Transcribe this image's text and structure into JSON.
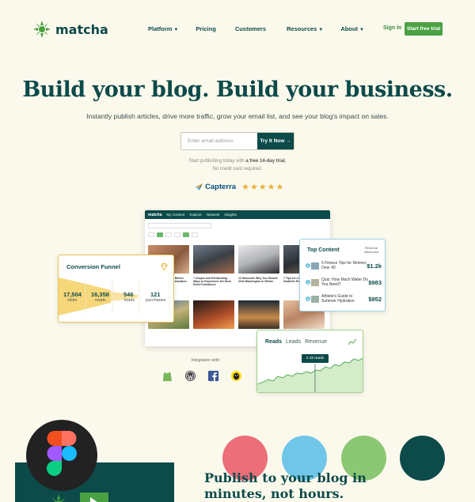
{
  "nav": {
    "brand": "matcha",
    "links": [
      {
        "label": "Platform",
        "caret": "▼"
      },
      {
        "label": "Pricing",
        "caret": ""
      },
      {
        "label": "Customers",
        "caret": ""
      },
      {
        "label": "Resources",
        "caret": "▼"
      },
      {
        "label": "About",
        "caret": "▼"
      }
    ],
    "sign_in": "Sign In",
    "cta": "Start free trial"
  },
  "hero": {
    "headline": "Build your blog. Build your business.",
    "subhead": "Instantly publish articles, drive more traffic, grow your email list, and see your blog's impact on sales.",
    "email_placeholder": "Enter email address",
    "cta": "Try It Now →",
    "trial_note_prefix": "Start publishing today with ",
    "trial_note_bold": "a free 14-day trial.",
    "trial_note_line2": "No credit card required.",
    "capterra": "Capterra",
    "stars": "★★★★★"
  },
  "app_mock": {
    "brand": "matcha",
    "menu": [
      "My Content",
      "Explore",
      "Network",
      "Insights"
    ],
    "captions": [
      "",
      "7 Historic Buildings Before and After a Great Restoration",
      "7 Unique and Exhilarating Ways to Experience the Best Rock Formations",
      "12 Museums Why You Should Visit Washington in Winter",
      "7 Tips for Living Better and Healthier Every Single Year"
    ]
  },
  "funnel": {
    "title": "Conversion Funnel",
    "stages": [
      {
        "value": "17,504",
        "label": "visits"
      },
      {
        "value": "16,358",
        "label": "reads"
      },
      {
        "value": "546",
        "label": "leads"
      },
      {
        "value": "121",
        "label": "purchases"
      }
    ]
  },
  "top_content": {
    "title": "Top Content",
    "revenue_label": "Revenue influenced",
    "rows": [
      {
        "rank": "1",
        "text": "5 Fitness Tips for Women Over 40",
        "value": "$1.2k"
      },
      {
        "rank": "2",
        "text": "Quiz: How Much Water Do You Need?",
        "value": "$983"
      },
      {
        "rank": "3",
        "text": "Athlete's Guide to Summer Hydration",
        "value": "$952"
      }
    ]
  },
  "reads_chart": {
    "tabs": [
      "Reads",
      "Leads",
      "Revenue"
    ],
    "tooltip": "2.1k reads"
  },
  "integrations": {
    "label": "Integrates with:",
    "icons": [
      "shopify-icon",
      "wordpress-icon",
      "facebook-icon",
      "mailchimp-icon"
    ]
  },
  "bottom": {
    "headline": "Publish to your blog in minutes, not hours."
  },
  "colors": {
    "primary": "#0d4a4a",
    "accent_green": "#4aa142",
    "background": "#fbf9ec",
    "funnel_yellow": "#f6d77a",
    "circle_red": "#ec6e78",
    "circle_blue": "#6fc6e8",
    "circle_green": "#8cc873",
    "circle_teal": "#0d4a4a"
  }
}
